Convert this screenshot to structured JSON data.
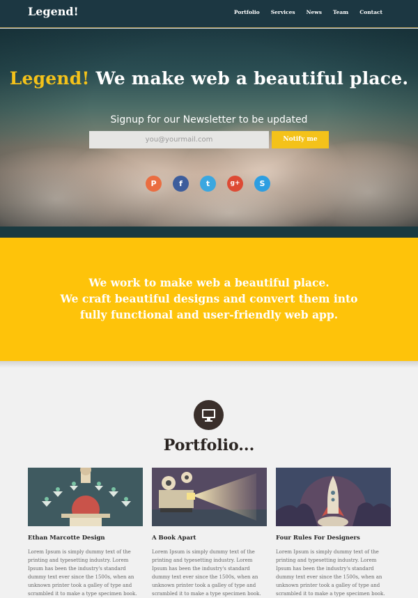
{
  "nav": {
    "brand": "Legend!",
    "items": [
      "Portfolio",
      "Services",
      "News",
      "Team",
      "Contact"
    ]
  },
  "hero": {
    "title_accent": "Legend!",
    "title_rest": "We make web a beautiful place.",
    "newsletter_text": "Signup for our Newsletter to be updated",
    "email_placeholder": "you@yourmail.com",
    "notify_label": "Notify me",
    "socials": [
      {
        "icon": "pinterest-icon",
        "glyph": "P",
        "color": "#ea6d41"
      },
      {
        "icon": "facebook-icon",
        "glyph": "f",
        "color": "#3d5d9c"
      },
      {
        "icon": "twitter-icon",
        "glyph": "t",
        "color": "#3aa7e0"
      },
      {
        "icon": "google-plus-icon",
        "glyph": "g+",
        "color": "#dd4a34"
      },
      {
        "icon": "skype-icon",
        "glyph": "S",
        "color": "#2d9ee1"
      }
    ]
  },
  "band": {
    "line1": "We work to make web a beautiful place.",
    "line2": "We craft beautiful designs and convert them into",
    "line3": "fully functional and user-friendly web app."
  },
  "portfolio": {
    "icon": "monitor-icon",
    "title": "Portfolio...",
    "items": [
      {
        "title": "Ethan Marcotte Design",
        "text": "Lorem Ipsum is simply dummy text of the printing and typesetting industry. Lorem Ipsum has been the industry's standard dummy text ever since the 1500s, when an unknown printer took a galley of type and scrambled it to make a type specimen book."
      },
      {
        "title": "A Book Apart",
        "text": "Lorem Ipsum is simply dummy text of the printing and typesetting industry. Lorem Ipsum has been the industry's standard dummy text ever since the 1500s, when an unknown printer took a galley of type and scrambled it to make a type specimen book."
      },
      {
        "title": "Four Rules For Designers",
        "text": "Lorem Ipsum is simply dummy text of the printing and typesetting industry. Lorem Ipsum has been the industry's standard dummy text ever since the 1500s, when an unknown printer took a galley of type and scrambled it to make a type specimen book."
      }
    ]
  },
  "colors": {
    "accent": "#fec30a",
    "nav_bg": "#1c3742",
    "text_dark": "#2b2522"
  }
}
